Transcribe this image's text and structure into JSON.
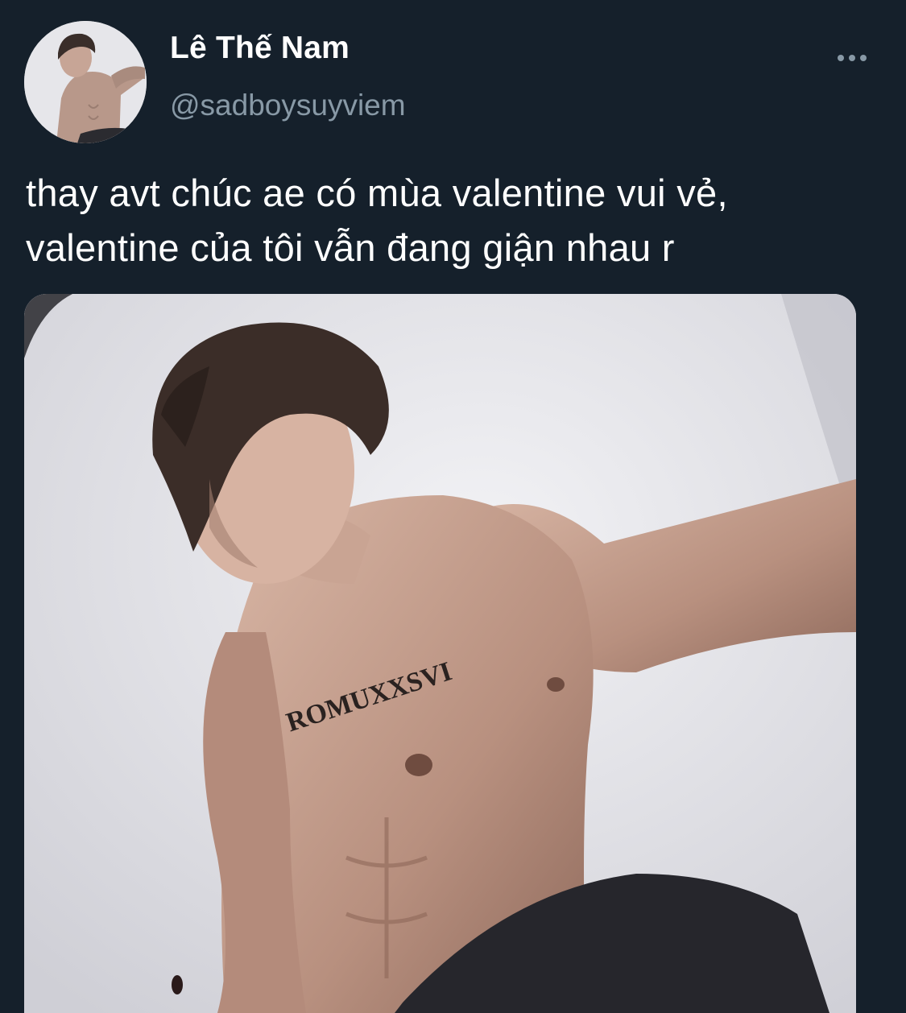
{
  "tweet": {
    "author": {
      "display_name": "Lê Thế Nam",
      "handle": "@sadboysuyviem"
    },
    "text_lines": [
      "thay avt chúc ae có mùa valentine vui vẻ,",
      "valentine của tôi vẫn đang giận nhau r"
    ],
    "media": {
      "tattoo_text": "ROMUXXSVI"
    },
    "more_icon": "more-horizontal-icon"
  },
  "colors": {
    "background": "#15202b",
    "primary_text": "#ffffff",
    "secondary_text": "#8899a6"
  }
}
